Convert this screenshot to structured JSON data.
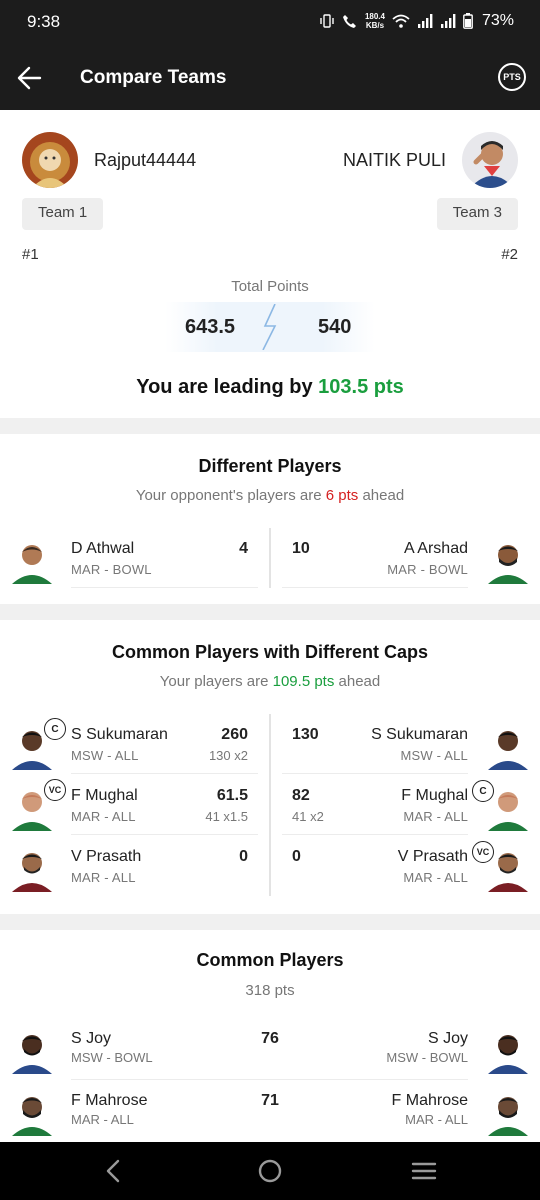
{
  "status": {
    "time": "9:38",
    "speed_value": "180.4",
    "speed_unit": "KB/s",
    "battery": "73%"
  },
  "app_bar": {
    "title": "Compare Teams",
    "pts_label": "PTS"
  },
  "left_user": {
    "name": "Rajput44444",
    "team": "Team 1",
    "rank": "#1",
    "points": "643.5"
  },
  "right_user": {
    "name": "NAITIK PULI",
    "team": "Team 3",
    "rank": "#2",
    "points": "540"
  },
  "total_points_label": "Total Points",
  "leading": {
    "prefix": "You are leading by ",
    "value": "103.5 pts"
  },
  "different_players": {
    "title": "Different Players",
    "sub_prefix": "Your opponent's players are ",
    "sub_value": "6 pts",
    "sub_suffix": " ahead",
    "left": [
      {
        "name": "D Athwal",
        "team": "MAR - BOWL",
        "points": "4",
        "calc": ""
      }
    ],
    "right": [
      {
        "name": "A Arshad",
        "team": "MAR - BOWL",
        "points": "10",
        "calc": ""
      }
    ]
  },
  "caps_players": {
    "title": "Common Players with Different Caps",
    "sub_prefix": "Your players are ",
    "sub_value": "109.5 pts",
    "sub_suffix": " ahead",
    "left": [
      {
        "name": "S Sukumaran",
        "team": "MSW - ALL",
        "points": "260",
        "calc": "130 x2",
        "cap": "C"
      },
      {
        "name": "F Mughal",
        "team": "MAR - ALL",
        "points": "61.5",
        "calc": "41 x1.5",
        "cap": "VC"
      },
      {
        "name": "V Prasath",
        "team": "MAR - ALL",
        "points": "0",
        "calc": "",
        "cap": ""
      }
    ],
    "right": [
      {
        "name": "S Sukumaran",
        "team": "MSW - ALL",
        "points": "130",
        "calc": "",
        "cap": ""
      },
      {
        "name": "F Mughal",
        "team": "MAR - ALL",
        "points": "82",
        "calc": "41 x2",
        "cap": "C"
      },
      {
        "name": "V Prasath",
        "team": "MAR - ALL",
        "points": "0",
        "calc": "",
        "cap": "VC"
      }
    ]
  },
  "common_players": {
    "title": "Common Players",
    "sub": "318 pts",
    "rows": [
      {
        "name": "S Joy",
        "team": "MSW - BOWL",
        "points": "76"
      },
      {
        "name": "F Mahrose",
        "team": "MAR - ALL",
        "points": "71"
      }
    ]
  },
  "colors": {
    "leading_green": "#1a9e3e",
    "behind_red": "#d52020",
    "app_bar_bg": "#1c1c1c"
  },
  "icons": [
    "back-arrow-icon",
    "pts-icon",
    "nav-back-icon",
    "nav-home-icon",
    "nav-recents-icon"
  ]
}
